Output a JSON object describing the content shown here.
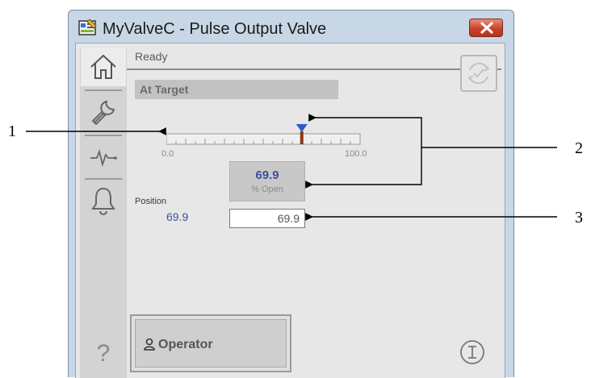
{
  "window": {
    "title": "MyValveC - Pulse Output Valve",
    "icon": "faceplate-app-icon",
    "close_icon": "close-x-icon"
  },
  "sidebar": {
    "tabs": [
      {
        "name": "home-tab",
        "icon": "home-icon",
        "active": true
      },
      {
        "name": "maintenance-tab",
        "icon": "wrench-icon",
        "active": false
      },
      {
        "name": "trends-tab",
        "icon": "trend-icon",
        "active": false
      },
      {
        "name": "alarms-tab",
        "icon": "bell-icon",
        "active": false
      }
    ],
    "help_label": "?"
  },
  "status": {
    "state": "Ready",
    "target": "At Target"
  },
  "scale": {
    "min_label": "0.0",
    "max_label": "100.0",
    "marker_value": 69.9
  },
  "valve": {
    "value": "69.9",
    "unit": "% Open"
  },
  "position": {
    "label": "Position",
    "value": "69.9",
    "input_value": "69.9"
  },
  "footer": {
    "operator_label": "Operator",
    "info_icon": "info-icon"
  },
  "callouts": {
    "c1": "1",
    "c2": "2",
    "c3": "3"
  },
  "colors": {
    "value_blue": "#3d4fa0",
    "marker_blue": "#2f57c8",
    "bar_brown": "#8a3a12",
    "close_red": "#c8432a"
  }
}
